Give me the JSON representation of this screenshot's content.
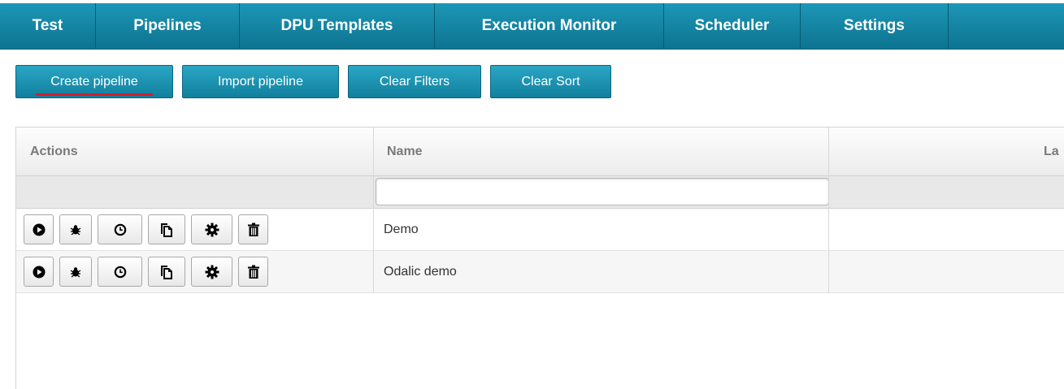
{
  "nav": {
    "items": [
      {
        "label": "Test"
      },
      {
        "label": "Pipelines"
      },
      {
        "label": "DPU Templates"
      },
      {
        "label": "Execution Monitor"
      },
      {
        "label": "Scheduler"
      },
      {
        "label": "Settings"
      }
    ]
  },
  "toolbar": {
    "create": "Create pipeline",
    "import": "Import pipeline",
    "clear_filters": "Clear Filters",
    "clear_sort": "Clear Sort"
  },
  "table": {
    "columns": [
      "Actions",
      "Name",
      "La"
    ],
    "filter_value": "",
    "rows": [
      {
        "name": "Demo"
      },
      {
        "name": "Odalic demo"
      }
    ],
    "row_actions": [
      "run-icon",
      "debug-icon",
      "schedule-icon",
      "copy-icon",
      "settings-icon",
      "delete-icon"
    ]
  },
  "colors": {
    "nav_bg": "#1a8fae",
    "button_bg": "#1a8fae",
    "active_underline": "#d01f2a"
  }
}
